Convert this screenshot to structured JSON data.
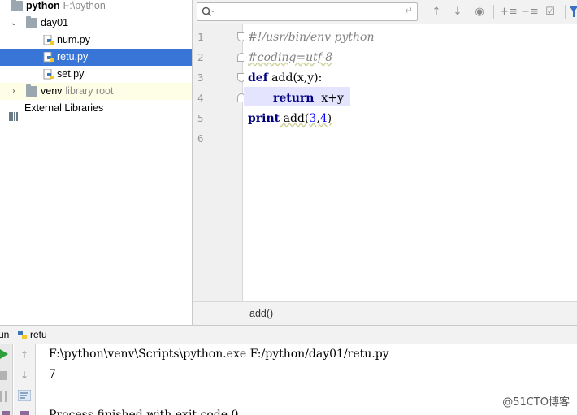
{
  "project_tree": {
    "root": {
      "name": "python",
      "path": "F:\\python"
    },
    "folder_day01": "day01",
    "files": [
      "num.py",
      "retu.py",
      "set.py"
    ],
    "venv": {
      "name": "venv",
      "note": "library root"
    },
    "external_libraries": "External Libraries"
  },
  "editor": {
    "search_value": "",
    "line_numbers": [
      "1",
      "2",
      "3",
      "4",
      "5",
      "6"
    ],
    "code": {
      "line1": "#!/usr/bin/env python",
      "line2": "#coding=utf-8",
      "line3_kw": "def",
      "line3_rest": " add(x,y):",
      "line4_kw": "return",
      "line4_rest": "  x+y",
      "line5_kw": "print",
      "line5_a": " add(",
      "line5_n1": "3",
      "line5_c": ",",
      "line5_n2": "4",
      "line5_e": ")"
    },
    "breadcrumb": "add()"
  },
  "run_panel": {
    "title": "un",
    "tab": "retu",
    "output": [
      "F:\\python\\venv\\Scripts\\python.exe F:/python/day01/retu.py",
      "7",
      "",
      "Process finished with exit code 0"
    ]
  },
  "watermark": "@51CTO博客",
  "colors": {
    "selection": "#3875d7",
    "keyword": "#000080",
    "number": "#0000ff",
    "comment": "#808080",
    "run_green": "#2e9e3a"
  }
}
